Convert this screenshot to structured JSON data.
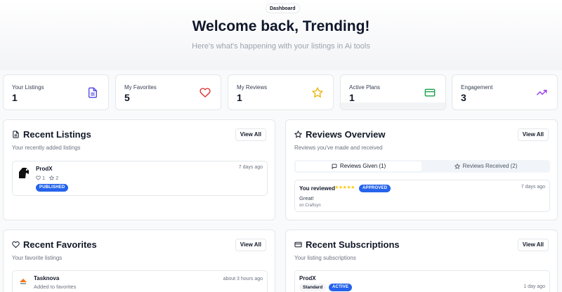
{
  "hero": {
    "badge": "Dashboard",
    "title": "Welcome back, Trending!",
    "subtitle": "Here's what's happening with your listings in Ai tools"
  },
  "stats": [
    {
      "label": "Your Listings",
      "value": "1",
      "icon": "document-icon",
      "color": "#4f46e5"
    },
    {
      "label": "My Favorites",
      "value": "5",
      "icon": "heart-icon",
      "color": "#dc2626"
    },
    {
      "label": "My Reviews",
      "value": "1",
      "icon": "star-icon",
      "color": "#eab308"
    },
    {
      "label": "Active Plans",
      "value": "1",
      "icon": "credit-card-icon",
      "color": "#16a34a"
    },
    {
      "label": "Engagement",
      "value": "3",
      "icon": "trending-up-icon",
      "color": "#9333ea"
    }
  ],
  "recent_listings": {
    "title": "Recent Listings",
    "subtitle": "Your recently added listings",
    "view_all": "View All",
    "items": [
      {
        "name": "ProdX",
        "time": "7 days ago",
        "likes": "1",
        "stars": "2",
        "status": "PUBLISHED"
      }
    ]
  },
  "reviews_overview": {
    "title": "Reviews Overview",
    "subtitle": "Reviews you've made and received",
    "view_all": "View All",
    "tabs": [
      {
        "label": "Reviews Given (1)",
        "active": true
      },
      {
        "label": "Reviews Received (2)",
        "active": false
      }
    ],
    "items": [
      {
        "lead": "You reviewed",
        "rating": "★★★★★",
        "status": "APPROVED",
        "time": "7 days ago",
        "text": "Great!",
        "target": "on Craftsyn"
      }
    ]
  },
  "recent_favorites": {
    "title": "Recent Favorites",
    "subtitle": "Your favorite listings",
    "view_all": "View All",
    "items": [
      {
        "name": "Tasknova",
        "note": "Added to favorites",
        "time": "about 3 hours ago"
      }
    ]
  },
  "recent_subscriptions": {
    "title": "Recent Subscriptions",
    "subtitle": "Your listing subscriptions",
    "view_all": "View All",
    "items": [
      {
        "name": "ProdX",
        "plan": "Standard",
        "status": "ACTIVE",
        "time": "1 day ago"
      }
    ]
  },
  "colors": {
    "accent": "#2563eb",
    "star": "#facc15"
  }
}
